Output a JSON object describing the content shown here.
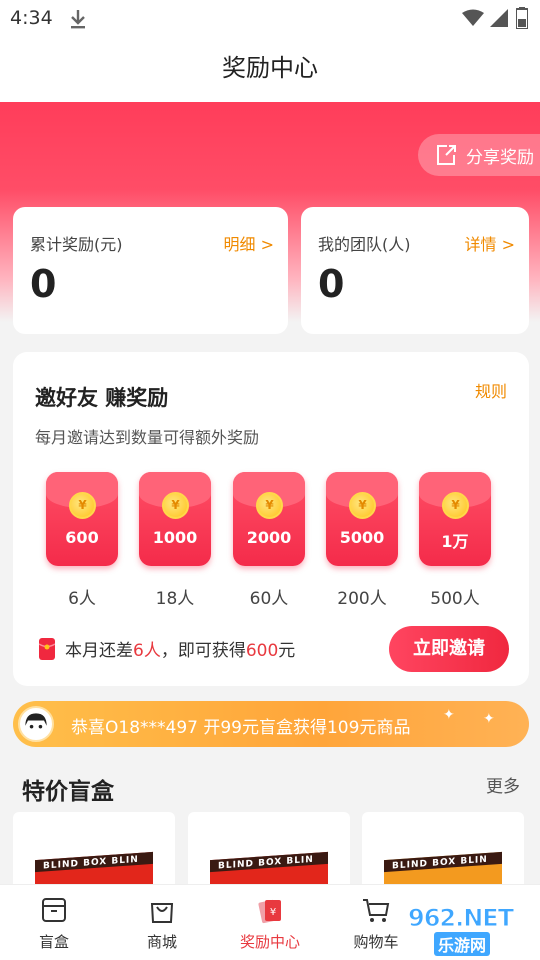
{
  "status_bar": {
    "time": "4:34"
  },
  "header": {
    "title": "奖励中心"
  },
  "share": {
    "label": "分享奖励"
  },
  "stats": [
    {
      "label": "累计奖励(元)",
      "link": "明细 >",
      "value": "0"
    },
    {
      "label": "我的团队(人)",
      "link": "详情 >",
      "value": "0"
    }
  ],
  "invite": {
    "title": "邀好友 赚奖励",
    "rules": "规则",
    "subtitle": "每月邀请达到数量可得额外奖励",
    "coin_symbol": "¥",
    "tiers": [
      {
        "amount": "600",
        "people": "6人"
      },
      {
        "amount": "1000",
        "people": "18人"
      },
      {
        "amount": "2000",
        "people": "60人"
      },
      {
        "amount": "5000",
        "people": "200人"
      },
      {
        "amount": "1万",
        "people": "500人"
      }
    ],
    "tip_prefix": "本月还差",
    "tip_count": "6人",
    "tip_middle": "，即可获得",
    "tip_amount": "600",
    "tip_suffix": "元",
    "button": "立即邀请"
  },
  "marquee": {
    "text": "恭喜O18***497 开99元盲盒获得109元商品"
  },
  "section": {
    "title": "特价盲盒",
    "more": "更多",
    "products": [
      {
        "label": "BLIND BOX BLIN"
      },
      {
        "label": "BLIND BOX BLIN"
      },
      {
        "label": "BLIND BOX BLIN"
      }
    ]
  },
  "nav": [
    {
      "label": "盲盒",
      "icon": "box-icon"
    },
    {
      "label": "商城",
      "icon": "shopping-bag-icon"
    },
    {
      "label": "奖励中心",
      "icon": "red-envelope-icon",
      "active": true
    },
    {
      "label": "购物车",
      "icon": "cart-icon"
    }
  ],
  "watermark": {
    "top": "962.NET",
    "bottom": "乐游网"
  },
  "colors": {
    "primary": "#ff3d5a",
    "accent": "#f08a00",
    "marquee": "#ffa53a"
  }
}
